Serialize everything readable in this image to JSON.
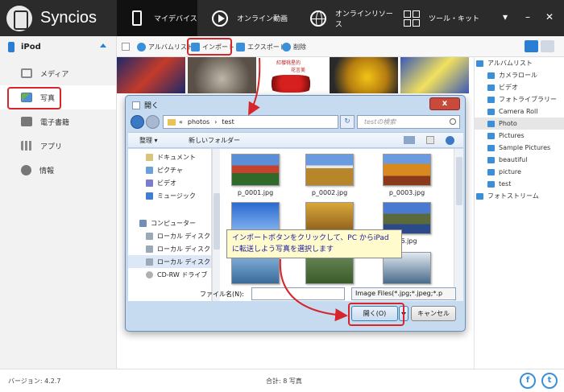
{
  "app": {
    "name": "Syncios"
  },
  "nav": {
    "tabs": [
      {
        "label": "マイデバイス",
        "icon": "phone-icon",
        "active": true
      },
      {
        "label": "オンライン動画",
        "icon": "play-icon",
        "active": false
      },
      {
        "label": "オンラインリソース",
        "icon": "globe-icon",
        "active": false
      },
      {
        "label": "ツール・キット",
        "icon": "toolkit-grid-icon",
        "active": false
      }
    ]
  },
  "sidebar": {
    "device": "iPod",
    "items": [
      {
        "label": "メディア",
        "icon": "media-icon"
      },
      {
        "label": "写真",
        "icon": "photo-icon",
        "active": true
      },
      {
        "label": "電子書籍",
        "icon": "ebook-icon"
      },
      {
        "label": "アプリ",
        "icon": "apps-icon"
      },
      {
        "label": "情報",
        "icon": "info-icon"
      }
    ]
  },
  "toolbar": {
    "album_list": "アルバムリスト",
    "import": "インポート",
    "export": "エクスポート",
    "delete": "削除"
  },
  "strip": {
    "caption_line1": "紅櫻桃星的",
    "caption_line2": "花言美"
  },
  "right_panel": {
    "items": [
      {
        "label": "アルバムリスト",
        "level": 0
      },
      {
        "label": "カメラロール",
        "level": 1
      },
      {
        "label": "ビデオ",
        "level": 1
      },
      {
        "label": "フォトライブラリー",
        "level": 1
      },
      {
        "label": "Camera Roll",
        "level": 1
      },
      {
        "label": "Photo",
        "level": 1,
        "selected": true
      },
      {
        "label": "Pictures",
        "level": 1
      },
      {
        "label": "Sample Pictures",
        "level": 1
      },
      {
        "label": "beautiful",
        "level": 1
      },
      {
        "label": "picture",
        "level": 1
      },
      {
        "label": "test",
        "level": 1
      },
      {
        "label": "フォトストリーム",
        "level": 0
      }
    ]
  },
  "dialog": {
    "title": "開く",
    "close": "x",
    "path_prefix": "«",
    "path_1": "photos",
    "path_sep": "›",
    "path_2": "test",
    "search_placeholder": "testの検索",
    "organize": "整理 ▾",
    "new_folder": "新しいフォルダー",
    "tree": [
      {
        "label": "ドキュメント",
        "color": "#d9c57a"
      },
      {
        "label": "ピクチャ",
        "color": "#6a9fd8"
      },
      {
        "label": "ビデオ",
        "color": "#7b7bd0"
      },
      {
        "label": "ミュージック",
        "color": "#3d7fd0"
      },
      {
        "label": "",
        "color": ""
      },
      {
        "label": "コンピューター",
        "color": "#6f8fb8"
      },
      {
        "label": "ローカル ディスク",
        "color": "#9aa8b8"
      },
      {
        "label": "ローカル ディスク",
        "color": "#9aa8b8"
      },
      {
        "label": "ローカル ディスク",
        "color": "#9aa8b8",
        "selected": true
      },
      {
        "label": "CD-RW ドライブ",
        "color": "#b0b0b0"
      }
    ],
    "files": [
      {
        "name": "p_0001.jpg"
      },
      {
        "name": "p_0002.jpg"
      },
      {
        "name": "p_0003.jpg"
      },
      {
        "name": ""
      },
      {
        "name": ""
      },
      {
        "name": "06.jpg"
      },
      {
        "name": ""
      },
      {
        "name": ""
      },
      {
        "name": ""
      }
    ],
    "filename_label": "ファイル名(N):",
    "filetype": "Image Files(*.jpg;*.jpeg;*.p",
    "open": "開く(O)",
    "cancel": "キャンセル"
  },
  "callout": {
    "text": "インポートボタンをクリックして、PC からiPad に転送しよう写真を選択します"
  },
  "footer": {
    "version": "バージョン: 4.2.7",
    "total": "合計: 8 写真"
  },
  "colors": {
    "topbar": "#2b2b2b",
    "accent": "#3b8fd8",
    "highlight": "#d6262c"
  }
}
